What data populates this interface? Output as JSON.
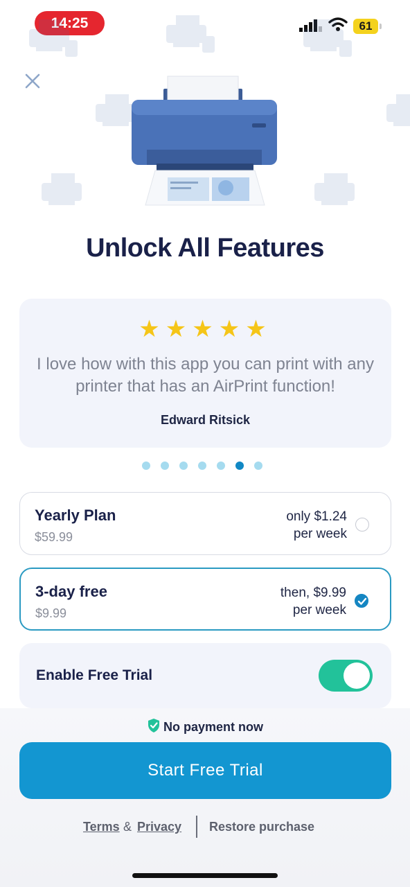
{
  "status_bar": {
    "time": "14:25",
    "battery": "61"
  },
  "paywall": {
    "title": "Unlock All Features",
    "review": {
      "stars": "★★★★★",
      "text": "I love how with this app you can print with any printer that has an AirPrint function!",
      "author": "Edward Ritsick"
    },
    "carousel": {
      "total": 7,
      "active_index": 5
    },
    "plans": [
      {
        "name": "Yearly Plan",
        "price": "$59.99",
        "right_line1": "only $1.24",
        "right_line2": "per week",
        "selected": false
      },
      {
        "name": "3-day free",
        "price": "$9.99",
        "right_line1": "then, $9.99",
        "right_line2": "per week",
        "selected": true
      }
    ],
    "free_trial_toggle": {
      "label": "Enable Free Trial",
      "on": true
    },
    "no_payment": "No payment now",
    "cta": "Start Free Trial",
    "footer": {
      "terms": "Terms",
      "amp": "&",
      "privacy": "Privacy",
      "restore": "Restore purchase"
    }
  },
  "colors": {
    "accent": "#1396d1",
    "toggle_on": "#22c29a",
    "star": "#f5c518",
    "title": "#1a2149"
  }
}
